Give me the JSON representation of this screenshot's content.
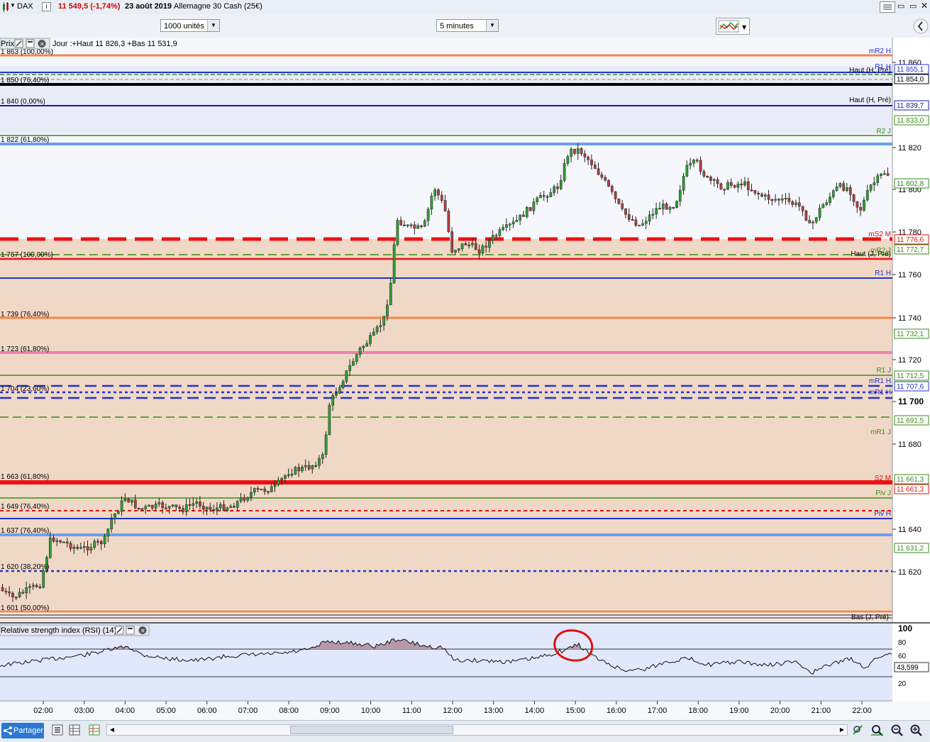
{
  "titlebar": {
    "instrument": "DAX",
    "price_change": "11 549,5 (-1,74%)",
    "date": "23 août 2019",
    "name": "Allemagne 30 Cash (25€)",
    "info_icon": "info-icon"
  },
  "toolbar": {
    "units_select": "1000 unités",
    "interval_select": "5 minutes"
  },
  "chart": {
    "panel_label": "Prix",
    "day_info": "Jour :+Haut 11 826,3 +Bas 11 531,9",
    "bottom_overlay": "Bas (J, Pré)",
    "rsi_label": "Relative strength index (RSI) (14)",
    "rsi_value": "43,599",
    "rsi_ticks": [
      "100",
      "80",
      "60",
      "20"
    ],
    "price_ticks": [
      "11 860",
      "11 820",
      "11 800",
      "11 780",
      "11 760",
      "11 740",
      "11 720",
      "11 700",
      "11 680",
      "11 640",
      "11 620"
    ],
    "price_boxes": [
      {
        "text": "11 855,1",
        "color": "#2233cc"
      },
      {
        "text": "11 854,0",
        "color": "#000000"
      },
      {
        "text": "11 839,7",
        "color": "#1a1aa0"
      },
      {
        "text": "11 833,0",
        "color": "#3a8a1a"
      },
      {
        "text": "11 802,8",
        "color": "#2f8a1a"
      },
      {
        "text": "11 776,6",
        "color": "#e01010"
      },
      {
        "text": "11 772,7",
        "color": "#3a8a1a"
      },
      {
        "text": "11 732,1",
        "color": "#3a8a1a"
      },
      {
        "text": "11 712,5",
        "color": "#3a8a1a"
      },
      {
        "text": "11 707,6",
        "color": "#2233cc"
      },
      {
        "text": "11 691,5",
        "color": "#3a8a1a"
      },
      {
        "text": "11 661,3",
        "color": "#3a8a1a"
      },
      {
        "text": "11 661,3",
        "color": "#e01010"
      },
      {
        "text": "11 631,2",
        "color": "#3a8a1a"
      }
    ],
    "line_labels_left": [
      "1 863 (100,00%)",
      "1 850 (76,40%)",
      "1 840 (0,00%)",
      "1 822 (61,80%)",
      "1 767 (100,00%)",
      "1 739 (76,40%)",
      "1 723 (61,80%)",
      "1 704 (23,60%)",
      "1 663 (61,80%)",
      "1 649 (76,40%)",
      "1 637 (76,40%)",
      "1 620 (38,20%)",
      "1 601 (50,00%)"
    ],
    "line_labels_right": [
      "mR2 H",
      "Haut (H, Pré)",
      "R1 H",
      "Haut (H, Pré)",
      "R2 J",
      "mS2 M",
      "Haut (J, Pré)",
      "mR2 J",
      "R1 H",
      "R1 J",
      "mR1 H",
      "mR1 H",
      "mR1 J",
      "S2 M",
      "Piv J",
      "Piv H"
    ],
    "time_ticks": [
      "02:00",
      "03:00",
      "04:00",
      "05:00",
      "06:00",
      "07:00",
      "08:00",
      "09:00",
      "10:00",
      "11:00",
      "12:00",
      "13:00",
      "14:00",
      "15:00",
      "16:00",
      "17:00",
      "18:00",
      "19:00",
      "20:00",
      "21:00",
      "22:00"
    ],
    "bold_tick": "11 700"
  },
  "statusbar": {
    "share_label": "Partager"
  },
  "colors": {
    "accent": "#2b78d4",
    "up_candle": "#2f9e2f",
    "down_candle": "#b04040",
    "zone_fill": "#f1d9c8",
    "annotation": "#dd1111"
  }
}
